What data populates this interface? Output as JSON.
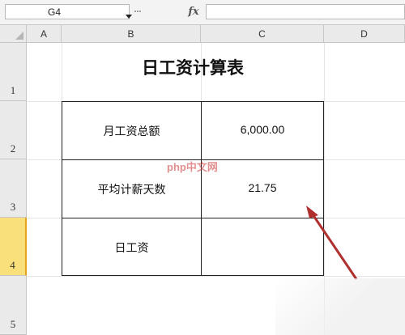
{
  "formula_bar": {
    "namebox": "G4",
    "fx": "fx",
    "formula": ""
  },
  "columns": [
    "A",
    "B",
    "C",
    "D"
  ],
  "rows": [
    "1",
    "2",
    "3",
    "4",
    "5"
  ],
  "selected_row": "4",
  "sheet": {
    "title": "日工资计算表",
    "table": [
      {
        "label": "月工资总额",
        "value": "6,000.00"
      },
      {
        "label": "平均计薪天数",
        "value": "21.75"
      },
      {
        "label": "日工资",
        "value": ""
      }
    ]
  },
  "watermark": "php中文网",
  "colors": {
    "selected_row_header": "#f9e07a",
    "arrow": "#b03030"
  }
}
